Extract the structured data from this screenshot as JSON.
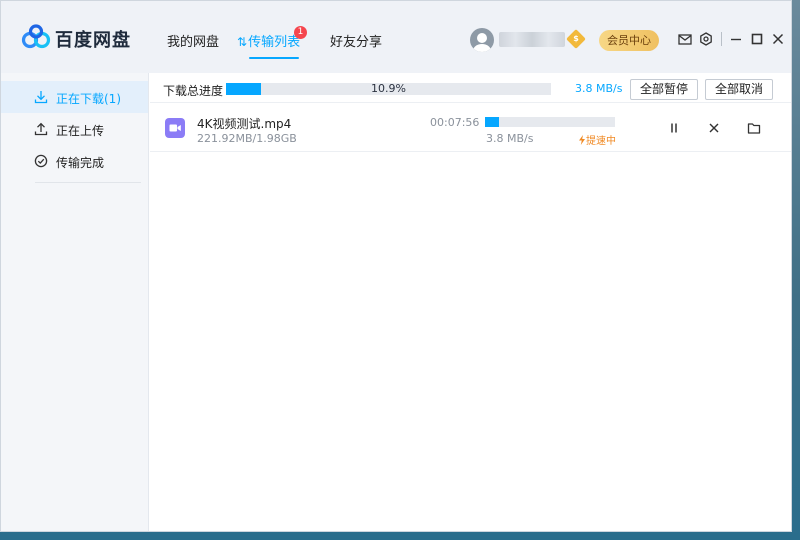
{
  "app": {
    "name": "百度网盘"
  },
  "nav": {
    "tabs": [
      {
        "label": "我的网盘"
      },
      {
        "label": "传输列表",
        "active": true,
        "badge": "1"
      },
      {
        "label": "好友分享"
      }
    ]
  },
  "header": {
    "vip_center": "会员中心",
    "vip_gem": "$",
    "icons": [
      "mail-icon",
      "settings-icon",
      "minimize-icon",
      "maximize-icon",
      "close-icon"
    ]
  },
  "sidebar": {
    "items": [
      {
        "label": "正在下载(1)",
        "icon": "download-icon",
        "active": true
      },
      {
        "label": "正在上传",
        "icon": "upload-icon"
      },
      {
        "label": "传输完成",
        "icon": "check-circle-icon"
      }
    ]
  },
  "total": {
    "label": "下载总进度",
    "percent_text": "10.9%",
    "progress": 0.109,
    "speed": "3.8 MB/s",
    "pause_all": "全部暂停",
    "cancel_all": "全部取消"
  },
  "downloads": [
    {
      "name": "4K视频测试.mp4",
      "size": "221.92MB/1.98GB",
      "time_left": "00:07:56",
      "progress": 0.109,
      "speed": "3.8 MB/s",
      "boost": "提速中",
      "file_icon": "video-file-icon"
    }
  ],
  "colors": {
    "accent": "#06a7ff",
    "badge": "#f5464e",
    "vip_gold": "#efc061",
    "boost_orange": "#f08a24",
    "video_icon": "#8b7cf6"
  }
}
